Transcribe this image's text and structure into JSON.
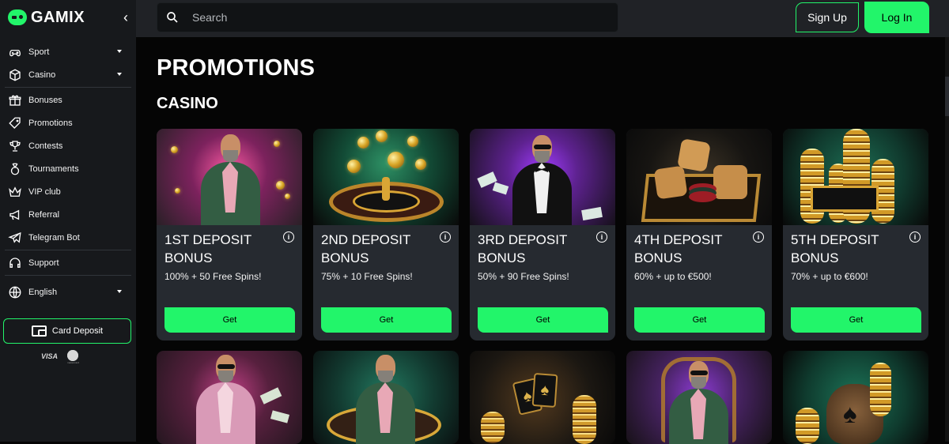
{
  "brand": {
    "name": "GAMIX"
  },
  "sidebar": {
    "collapse_icon": "chevron-left-icon",
    "items": [
      {
        "label": "Sport",
        "icon": "gamepad-icon",
        "dropdown": true
      },
      {
        "label": "Casino",
        "icon": "dice-icon",
        "dropdown": true
      },
      {
        "label": "Bonuses",
        "icon": "gift-icon",
        "dropdown": false
      },
      {
        "label": "Promotions",
        "icon": "tag-icon",
        "dropdown": false
      },
      {
        "label": "Contests",
        "icon": "trophy-icon",
        "dropdown": false
      },
      {
        "label": "Tournaments",
        "icon": "medal-icon",
        "dropdown": false
      },
      {
        "label": "VIP club",
        "icon": "crown-icon",
        "dropdown": false
      },
      {
        "label": "Referral",
        "icon": "megaphone-icon",
        "dropdown": false
      },
      {
        "label": "Telegram Bot",
        "icon": "telegram-icon",
        "dropdown": false
      },
      {
        "label": "Support",
        "icon": "headset-icon",
        "dropdown": false
      },
      {
        "label": "English",
        "icon": "globe-icon",
        "dropdown": true
      }
    ],
    "card_deposit": "Card Deposit",
    "payment_visa": "VISA",
    "payment_master": "mastercard"
  },
  "header": {
    "search_placeholder": "Search",
    "signup": "Sign Up",
    "login": "Log In"
  },
  "main": {
    "title": "PROMOTIONS",
    "section": "CASINO",
    "promos": [
      {
        "title": "1ST DEPOSIT BONUS",
        "subtitle": "100% + 50 Free Spins!",
        "button": "Get"
      },
      {
        "title": "2ND DEPOSIT BONUS",
        "subtitle": "75% + 10 Free Spins!",
        "button": "Get"
      },
      {
        "title": "3RD DEPOSIT BONUS",
        "subtitle": "50% + 90 Free Spins!",
        "button": "Get"
      },
      {
        "title": "4TH DEPOSIT BONUS",
        "subtitle": "60% + up to €500!",
        "button": "Get"
      },
      {
        "title": "5TH DEPOSIT BONUS",
        "subtitle": "70% + up to €600!",
        "button": "Get"
      }
    ]
  },
  "colors": {
    "accent": "#22f56a",
    "sidebar": "#17191c",
    "card": "#262a30",
    "background": "#050505"
  }
}
